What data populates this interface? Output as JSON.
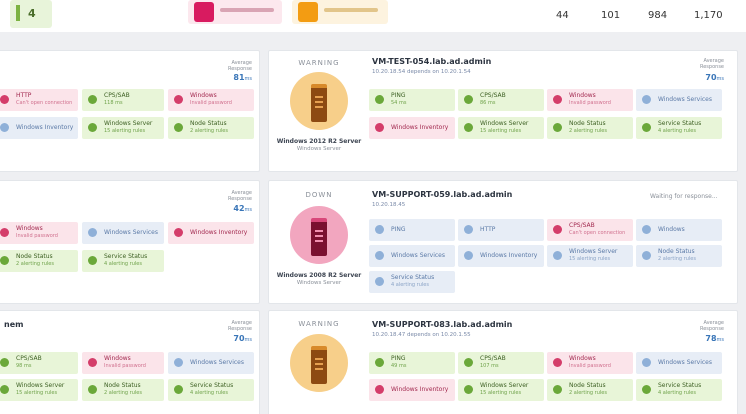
{
  "top": {
    "kpi_value": "4",
    "counts": [
      "44",
      "101",
      "984",
      "1,170"
    ]
  },
  "colors": {
    "green": "#7cb342",
    "critical": "#d81b60",
    "warning": "#f39c12",
    "link": "#3a76b8"
  },
  "left_cards": [
    {
      "response_label": "Average Response",
      "response_value": "81",
      "response_unit": "ms",
      "tiles": [
        {
          "color": "pink",
          "title": "HTTP",
          "sub": "Can't open connection",
          "icon": "alert-icon"
        },
        {
          "color": "green",
          "title": "CPS/SAB",
          "sub": "118 ms",
          "icon": "check-icon"
        },
        {
          "color": "pink",
          "title": "Windows",
          "sub": "Invalid password",
          "icon": "alert-icon"
        },
        {
          "color": "blue",
          "title": "Windows Inventory",
          "sub": "",
          "icon": "info-icon"
        },
        {
          "color": "green",
          "title": "Windows Server",
          "sub": "15 alerting rules",
          "icon": "check-icon"
        },
        {
          "color": "green",
          "title": "Node Status",
          "sub": "2 alerting rules",
          "icon": "check-icon"
        }
      ]
    },
    {
      "response_label": "Average Response",
      "response_value": "42",
      "response_unit": "ms",
      "tiles": [
        {
          "color": "pink",
          "title": "Windows",
          "sub": "Invalid password",
          "icon": "alert-icon"
        },
        {
          "color": "blue",
          "title": "Windows Services",
          "sub": "",
          "icon": "info-icon"
        },
        {
          "color": "pink",
          "title": "Windows Inventory",
          "sub": "",
          "icon": "alert-icon"
        },
        {
          "color": "green",
          "title": "Node Status",
          "sub": "2 alerting rules",
          "icon": "check-icon"
        },
        {
          "color": "green",
          "title": "Service Status",
          "sub": "4 alerting rules",
          "icon": "check-icon"
        }
      ]
    },
    {
      "title": "nem",
      "response_label": "Average Response",
      "response_value": "70",
      "response_unit": "ms",
      "tiles": [
        {
          "color": "green",
          "title": "CPS/SAB",
          "sub": "98 ms",
          "icon": "check-icon"
        },
        {
          "color": "pink",
          "title": "Windows",
          "sub": "Invalid password",
          "icon": "alert-icon"
        },
        {
          "color": "blue",
          "title": "Windows Services",
          "sub": "",
          "icon": "info-icon"
        },
        {
          "color": "green",
          "title": "Windows Server",
          "sub": "15 alerting rules",
          "icon": "check-icon"
        },
        {
          "color": "green",
          "title": "Node Status",
          "sub": "2 alerting rules",
          "icon": "check-icon"
        },
        {
          "color": "green",
          "title": "Service Status",
          "sub": "4 alerting rules",
          "icon": "check-icon"
        }
      ]
    }
  ],
  "right_cards": [
    {
      "state": "WARNING",
      "os": "Windows 2012 R2 Server",
      "os_type": "Windows Server",
      "host": "VM-TEST-054.lab.ad.admin",
      "depends": "10.20.18.54 depends on 10.20.1.54",
      "response_label": "Average Response",
      "response_value": "70",
      "response_unit": "ms",
      "tiles": [
        {
          "color": "green",
          "title": "PING",
          "sub": "54 ms",
          "icon": "check-icon"
        },
        {
          "color": "green",
          "title": "CPS/SAB",
          "sub": "86 ms",
          "icon": "check-icon"
        },
        {
          "color": "pink",
          "title": "Windows",
          "sub": "Invalid password",
          "icon": "alert-icon"
        },
        {
          "color": "blue",
          "title": "Windows Services",
          "sub": "",
          "icon": "info-icon"
        },
        {
          "color": "pink",
          "title": "Windows Inventory",
          "sub": "",
          "icon": "alert-icon"
        },
        {
          "color": "green",
          "title": "Windows Server",
          "sub": "15 alerting rules",
          "icon": "check-icon"
        },
        {
          "color": "green",
          "title": "Node Status",
          "sub": "2 alerting rules",
          "icon": "check-icon"
        },
        {
          "color": "green",
          "title": "Service Status",
          "sub": "4 alerting rules",
          "icon": "check-icon"
        }
      ]
    },
    {
      "state": "DOWN",
      "os": "Windows 2008 R2 Server",
      "os_type": "Windows Server",
      "host": "VM-SUPPORT-059.lab.ad.admin",
      "depends": "10.20.18.45",
      "waiting": "Waiting for response...",
      "tiles": [
        {
          "color": "blue",
          "title": "PING",
          "sub": "",
          "icon": "info-icon"
        },
        {
          "color": "blue",
          "title": "HTTP",
          "sub": "",
          "icon": "info-icon"
        },
        {
          "color": "pink",
          "title": "CPS/SAB",
          "sub": "Can't open connection",
          "icon": "alert-icon"
        },
        {
          "color": "blue",
          "title": "Windows",
          "sub": "",
          "icon": "info-icon"
        },
        {
          "color": "blue",
          "title": "Windows Services",
          "sub": "",
          "icon": "info-icon"
        },
        {
          "color": "blue",
          "title": "Windows Inventory",
          "sub": "",
          "icon": "info-icon"
        },
        {
          "color": "blue",
          "title": "Windows Server",
          "sub": "15 alerting rules",
          "icon": "info-icon"
        },
        {
          "color": "blue",
          "title": "Node Status",
          "sub": "2 alerting rules",
          "icon": "info-icon"
        },
        {
          "color": "blue",
          "title": "Service Status",
          "sub": "4 alerting rules",
          "icon": "info-icon"
        }
      ]
    },
    {
      "state": "WARNING",
      "host": "VM-SUPPORT-083.lab.ad.admin",
      "depends": "10.20.18.47 depends on 10.20.1.55",
      "response_label": "Average Response",
      "response_value": "78",
      "response_unit": "ms",
      "tiles": [
        {
          "color": "green",
          "title": "PING",
          "sub": "49 ms",
          "icon": "check-icon"
        },
        {
          "color": "green",
          "title": "CPS/SAB",
          "sub": "107 ms",
          "icon": "check-icon"
        },
        {
          "color": "pink",
          "title": "Windows",
          "sub": "Invalid password",
          "icon": "alert-icon"
        },
        {
          "color": "blue",
          "title": "Windows Services",
          "sub": "",
          "icon": "info-icon"
        },
        {
          "color": "pink",
          "title": "Windows Inventory",
          "sub": "",
          "icon": "alert-icon"
        },
        {
          "color": "green",
          "title": "Windows Server",
          "sub": "15 alerting rules",
          "icon": "check-icon"
        },
        {
          "color": "green",
          "title": "Node Status",
          "sub": "2 alerting rules",
          "icon": "check-icon"
        },
        {
          "color": "green",
          "title": "Service Status",
          "sub": "4 alerting rules",
          "icon": "check-icon"
        }
      ]
    }
  ]
}
